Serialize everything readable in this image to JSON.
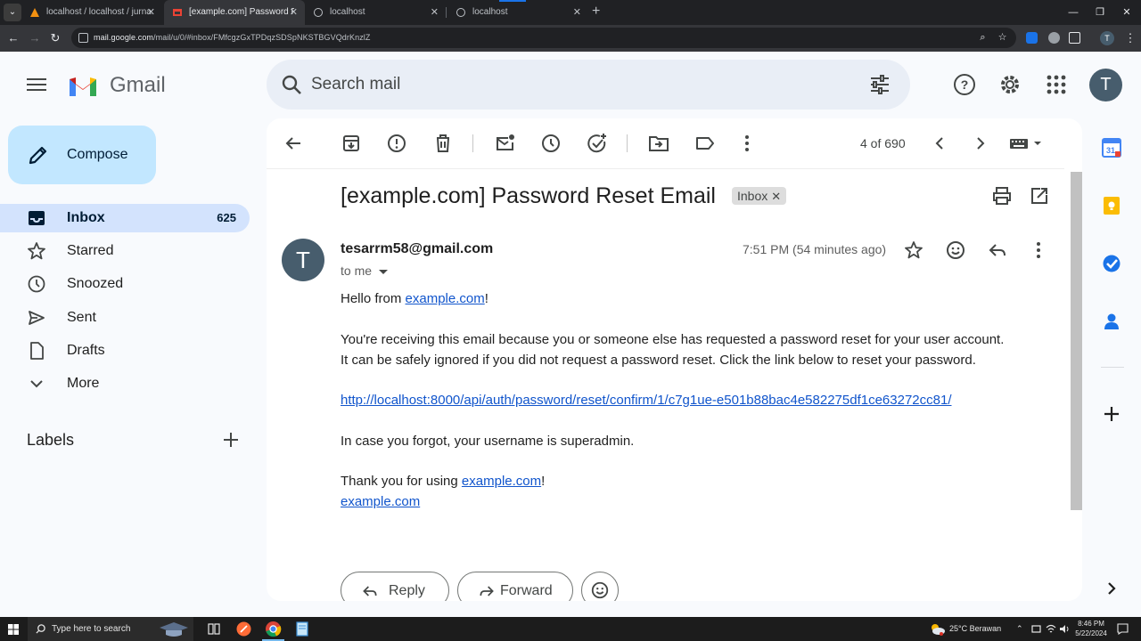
{
  "browser": {
    "tabs": [
      {
        "title": "localhost / localhost / jurnal_m",
        "active": false,
        "icon": "phpmyadmin-icon"
      },
      {
        "title": "[example.com] Password Reset",
        "active": true,
        "icon": "gmail-icon"
      },
      {
        "title": "localhost",
        "active": false,
        "icon": "globe-icon"
      },
      {
        "title": "localhost",
        "active": false,
        "icon": "globe-icon"
      }
    ],
    "url_host": "mail.google.com",
    "url_path": "/mail/u/0/#inbox/FMfcgzGxTPDqzSDSpNKSTBGVQdrKnzlZ",
    "profile_initial": "T"
  },
  "gmail": {
    "logo_text": "Gmail",
    "compose_label": "Compose",
    "search_placeholder": "Search mail",
    "avatar_initial": "T",
    "nav": [
      {
        "label": "Inbox",
        "count": "625",
        "icon": "inbox-icon",
        "active": true
      },
      {
        "label": "Starred",
        "count": "",
        "icon": "star-icon",
        "active": false
      },
      {
        "label": "Snoozed",
        "count": "",
        "icon": "clock-icon",
        "active": false
      },
      {
        "label": "Sent",
        "count": "",
        "icon": "send-icon",
        "active": false
      },
      {
        "label": "Drafts",
        "count": "",
        "icon": "draft-icon",
        "active": false
      },
      {
        "label": "More",
        "count": "",
        "icon": "chevron-down-icon",
        "active": false
      }
    ],
    "labels_heading": "Labels"
  },
  "message": {
    "pager": "4 of 690",
    "subject": "[example.com] Password Reset Email",
    "label_chip": "Inbox",
    "sender_initial": "T",
    "sender": "tesarrm58@gmail.com",
    "to": "to me",
    "time": "7:51 PM (54 minutes ago)",
    "body": {
      "greeting_prefix": "Hello from ",
      "greeting_link": "example.com",
      "greeting_suffix": "!",
      "para1_line1": "You're receiving this email because you or someone else has requested a password reset for your user account.",
      "para1_line2": "It can be safely ignored if you did not request a password reset. Click the link below to reset your password.",
      "reset_link": "http://localhost:8000/api/auth/password/reset/confirm/1/c7g1ue-e501b88bac4e582275df1ce63272cc81/",
      "username_line": "In case you forgot, your username is superadmin.",
      "thanks_prefix": "Thank you for using ",
      "thanks_link": "example.com",
      "thanks_suffix": "!",
      "signature_link": "example.com"
    },
    "reply_label": "Reply",
    "forward_label": "Forward"
  },
  "taskbar": {
    "search_text": "Type here to search",
    "weather": "25°C  Berawan",
    "time": "8:46 PM",
    "date": "5/22/2024"
  },
  "colors": {
    "compose_bg": "#c2e7ff",
    "active_nav_bg": "#d3e3fd",
    "link": "#1155cc",
    "avatar_bg": "#475d6d"
  }
}
